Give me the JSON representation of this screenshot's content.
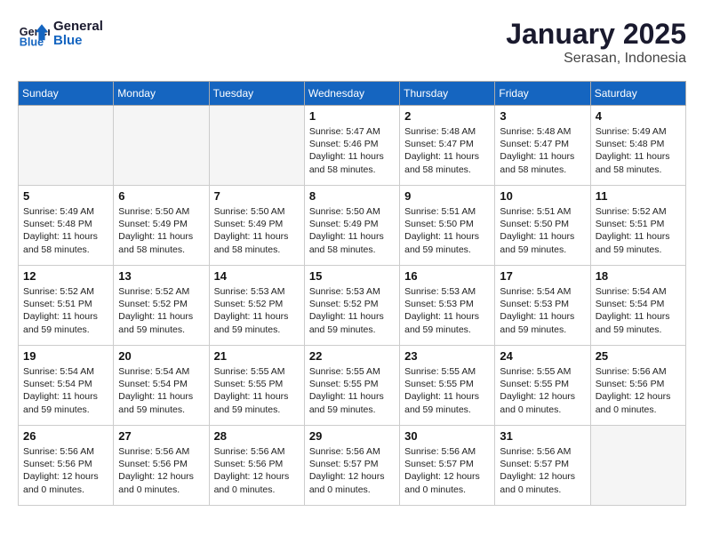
{
  "logo": {
    "line1": "General",
    "line2": "Blue"
  },
  "title": "January 2025",
  "subtitle": "Serasan, Indonesia",
  "days_of_week": [
    "Sunday",
    "Monday",
    "Tuesday",
    "Wednesday",
    "Thursday",
    "Friday",
    "Saturday"
  ],
  "weeks": [
    [
      {
        "day": "",
        "empty": true
      },
      {
        "day": "",
        "empty": true
      },
      {
        "day": "",
        "empty": true
      },
      {
        "day": "1",
        "sunrise": "5:47 AM",
        "sunset": "5:46 PM",
        "daylight": "11 hours and 58 minutes."
      },
      {
        "day": "2",
        "sunrise": "5:48 AM",
        "sunset": "5:47 PM",
        "daylight": "11 hours and 58 minutes."
      },
      {
        "day": "3",
        "sunrise": "5:48 AM",
        "sunset": "5:47 PM",
        "daylight": "11 hours and 58 minutes."
      },
      {
        "day": "4",
        "sunrise": "5:49 AM",
        "sunset": "5:48 PM",
        "daylight": "11 hours and 58 minutes."
      }
    ],
    [
      {
        "day": "5",
        "sunrise": "5:49 AM",
        "sunset": "5:48 PM",
        "daylight": "11 hours and 58 minutes."
      },
      {
        "day": "6",
        "sunrise": "5:50 AM",
        "sunset": "5:49 PM",
        "daylight": "11 hours and 58 minutes."
      },
      {
        "day": "7",
        "sunrise": "5:50 AM",
        "sunset": "5:49 PM",
        "daylight": "11 hours and 58 minutes."
      },
      {
        "day": "8",
        "sunrise": "5:50 AM",
        "sunset": "5:49 PM",
        "daylight": "11 hours and 58 minutes."
      },
      {
        "day": "9",
        "sunrise": "5:51 AM",
        "sunset": "5:50 PM",
        "daylight": "11 hours and 59 minutes."
      },
      {
        "day": "10",
        "sunrise": "5:51 AM",
        "sunset": "5:50 PM",
        "daylight": "11 hours and 59 minutes."
      },
      {
        "day": "11",
        "sunrise": "5:52 AM",
        "sunset": "5:51 PM",
        "daylight": "11 hours and 59 minutes."
      }
    ],
    [
      {
        "day": "12",
        "sunrise": "5:52 AM",
        "sunset": "5:51 PM",
        "daylight": "11 hours and 59 minutes."
      },
      {
        "day": "13",
        "sunrise": "5:52 AM",
        "sunset": "5:52 PM",
        "daylight": "11 hours and 59 minutes."
      },
      {
        "day": "14",
        "sunrise": "5:53 AM",
        "sunset": "5:52 PM",
        "daylight": "11 hours and 59 minutes."
      },
      {
        "day": "15",
        "sunrise": "5:53 AM",
        "sunset": "5:52 PM",
        "daylight": "11 hours and 59 minutes."
      },
      {
        "day": "16",
        "sunrise": "5:53 AM",
        "sunset": "5:53 PM",
        "daylight": "11 hours and 59 minutes."
      },
      {
        "day": "17",
        "sunrise": "5:54 AM",
        "sunset": "5:53 PM",
        "daylight": "11 hours and 59 minutes."
      },
      {
        "day": "18",
        "sunrise": "5:54 AM",
        "sunset": "5:54 PM",
        "daylight": "11 hours and 59 minutes."
      }
    ],
    [
      {
        "day": "19",
        "sunrise": "5:54 AM",
        "sunset": "5:54 PM",
        "daylight": "11 hours and 59 minutes."
      },
      {
        "day": "20",
        "sunrise": "5:54 AM",
        "sunset": "5:54 PM",
        "daylight": "11 hours and 59 minutes."
      },
      {
        "day": "21",
        "sunrise": "5:55 AM",
        "sunset": "5:55 PM",
        "daylight": "11 hours and 59 minutes."
      },
      {
        "day": "22",
        "sunrise": "5:55 AM",
        "sunset": "5:55 PM",
        "daylight": "11 hours and 59 minutes."
      },
      {
        "day": "23",
        "sunrise": "5:55 AM",
        "sunset": "5:55 PM",
        "daylight": "11 hours and 59 minutes."
      },
      {
        "day": "24",
        "sunrise": "5:55 AM",
        "sunset": "5:55 PM",
        "daylight": "12 hours and 0 minutes."
      },
      {
        "day": "25",
        "sunrise": "5:56 AM",
        "sunset": "5:56 PM",
        "daylight": "12 hours and 0 minutes."
      }
    ],
    [
      {
        "day": "26",
        "sunrise": "5:56 AM",
        "sunset": "5:56 PM",
        "daylight": "12 hours and 0 minutes."
      },
      {
        "day": "27",
        "sunrise": "5:56 AM",
        "sunset": "5:56 PM",
        "daylight": "12 hours and 0 minutes."
      },
      {
        "day": "28",
        "sunrise": "5:56 AM",
        "sunset": "5:56 PM",
        "daylight": "12 hours and 0 minutes."
      },
      {
        "day": "29",
        "sunrise": "5:56 AM",
        "sunset": "5:57 PM",
        "daylight": "12 hours and 0 minutes."
      },
      {
        "day": "30",
        "sunrise": "5:56 AM",
        "sunset": "5:57 PM",
        "daylight": "12 hours and 0 minutes."
      },
      {
        "day": "31",
        "sunrise": "5:56 AM",
        "sunset": "5:57 PM",
        "daylight": "12 hours and 0 minutes."
      },
      {
        "day": "",
        "empty": true
      }
    ]
  ],
  "labels": {
    "sunrise": "Sunrise:",
    "sunset": "Sunset:",
    "daylight": "Daylight:"
  }
}
